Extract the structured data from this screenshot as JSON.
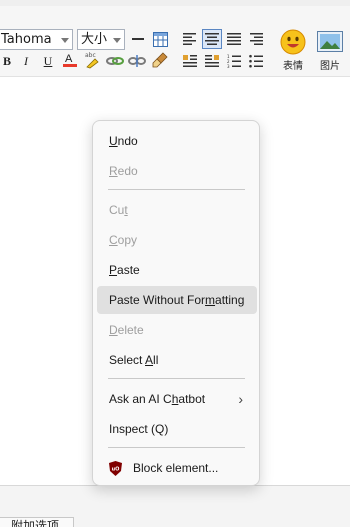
{
  "toolbar": {
    "font_family": "Tahoma",
    "font_size": "大小",
    "emoji_label": "表情",
    "image_label": "图片"
  },
  "context_menu": {
    "undo": {
      "pre": "",
      "u": "U",
      "post": "ndo"
    },
    "redo": {
      "pre": "",
      "u": "R",
      "post": "edo"
    },
    "cut": {
      "pre": "Cu",
      "u": "t",
      "post": ""
    },
    "copy": {
      "pre": "",
      "u": "C",
      "post": "opy"
    },
    "paste": {
      "pre": "",
      "u": "P",
      "post": "aste"
    },
    "paste_plain": {
      "pre": "Paste Without For",
      "u": "m",
      "post": "atting"
    },
    "delete": {
      "pre": "",
      "u": "D",
      "post": "elete"
    },
    "select_all": {
      "pre": "Select ",
      "u": "A",
      "post": "ll"
    },
    "ai_chatbot": {
      "pre": "Ask an AI C",
      "u": "h",
      "post": "atbot"
    },
    "inspect": "Inspect (Q)",
    "block_element": "Block element..."
  },
  "bottom": {
    "options_tab": "附加选项"
  },
  "colors": {
    "menu_bg": "#f9f9f9",
    "menu_highlight": "#e0e0e0",
    "disabled_text": "#9e9e9e",
    "ublock_red": "#800000"
  }
}
